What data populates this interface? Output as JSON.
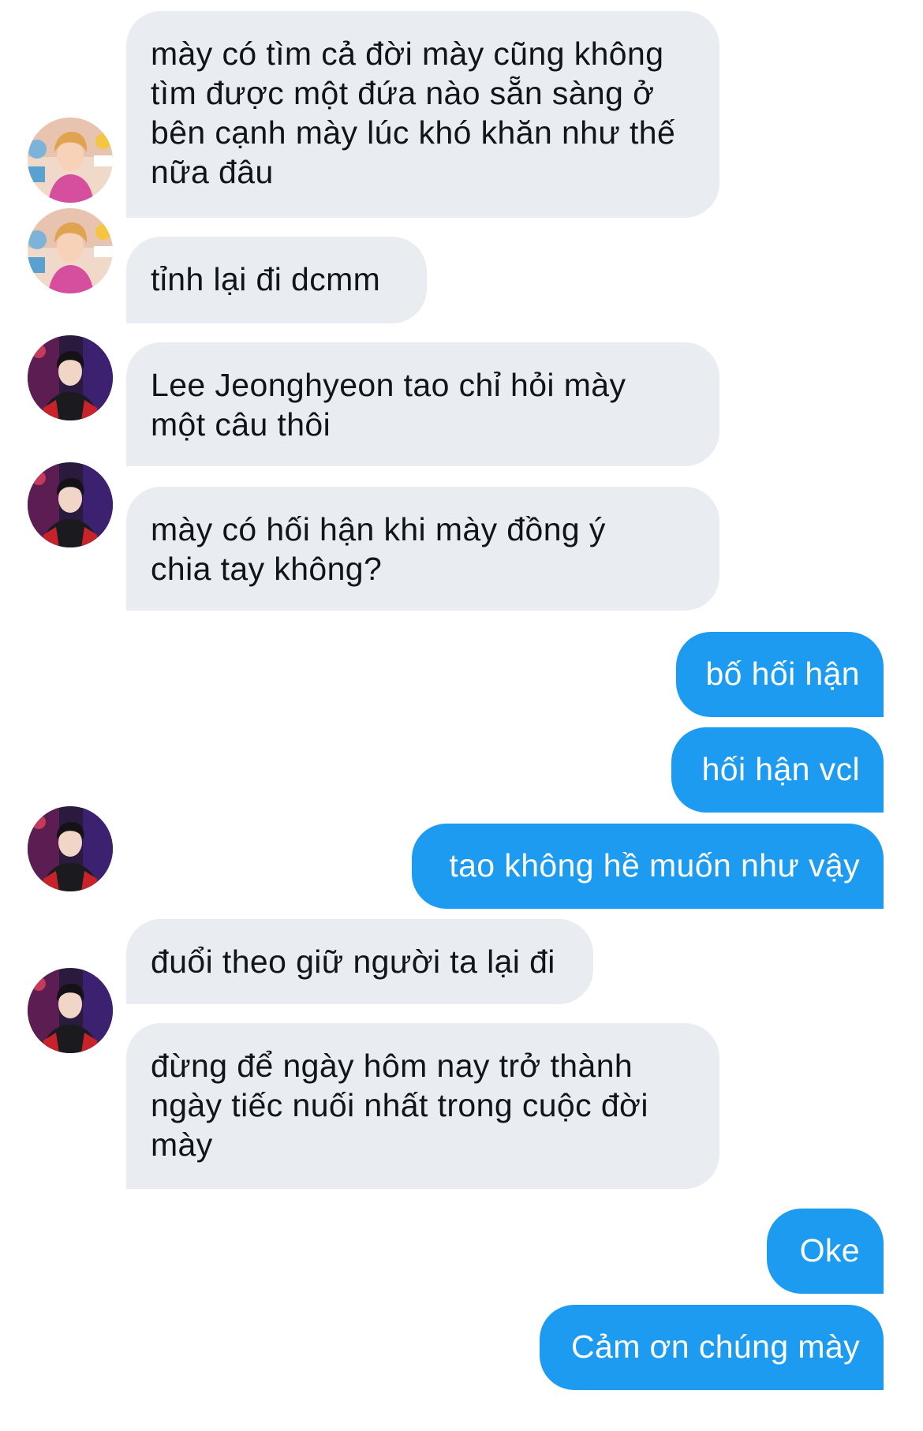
{
  "colors": {
    "incoming_bubble": "#e9ecf0",
    "outgoing_bubble": "#1d9bf0",
    "incoming_text": "#111418",
    "outgoing_text": "#ffffff",
    "background": "#ffffff"
  },
  "avatars": {
    "a": "avatar-icon-pink-outfit-blond-hair",
    "b": "avatar-icon-red-black-stage-outfit"
  },
  "messages": [
    {
      "sender": "a",
      "direction": "incoming",
      "text": "mày có tìm cả đời mày cũng không\ntìm được một đứa nào sẵn sàng ở\nbên cạnh mày lúc khó khăn như thế\nnữa đâu"
    },
    {
      "sender": "a",
      "direction": "incoming",
      "text": "tỉnh lại đi dcmm"
    },
    {
      "sender": "b",
      "direction": "incoming",
      "text": "Lee Jeonghyeon tao chỉ hỏi mày\nmột câu thôi"
    },
    {
      "sender": "b",
      "direction": "incoming",
      "text": "mày có hối hận khi mày đồng ý\nchia tay không?"
    },
    {
      "sender": "me",
      "direction": "outgoing",
      "text": "bố hối hận"
    },
    {
      "sender": "me",
      "direction": "outgoing",
      "text": "hối hận vcl"
    },
    {
      "sender": "me",
      "direction": "outgoing",
      "text": "tao không hề muốn như vậy"
    },
    {
      "sender": "b",
      "direction": "incoming",
      "text": "đuổi theo giữ người ta lại đi"
    },
    {
      "sender": "b",
      "direction": "incoming",
      "text": "đừng để ngày hôm nay trở thành\nngày tiếc nuối nhất trong cuộc đời\nmày"
    },
    {
      "sender": "me",
      "direction": "outgoing",
      "text": "Oke"
    },
    {
      "sender": "me",
      "direction": "outgoing",
      "text": "Cảm ơn chúng mày"
    }
  ]
}
